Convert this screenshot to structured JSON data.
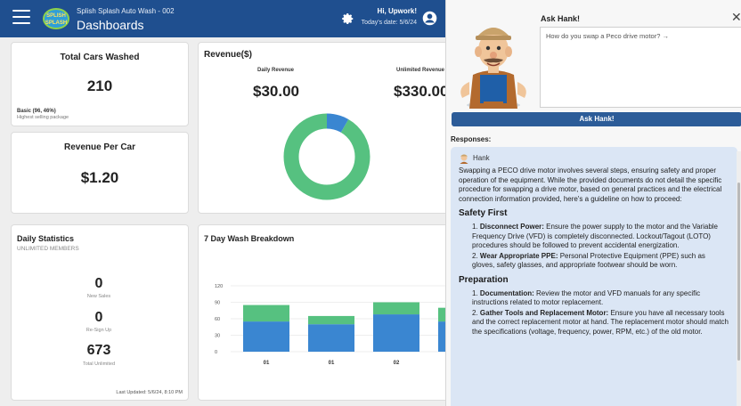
{
  "header": {
    "subtitle": "Splish Splash Auto Wash - 002",
    "title": "Dashboards",
    "logo_text": "SPLISH SPLASH",
    "greeting": "Hi, Upwork!",
    "today": "Today's date: 5/6/24"
  },
  "cards": {
    "total_cars": {
      "title": "Total Cars Washed",
      "value": "210",
      "top_package": "Basic (96, 46%)",
      "top_package_caption": "Highest selling package"
    },
    "revenue_per_car": {
      "title": "Revenue Per Car",
      "value": "$1.20"
    },
    "revenue": {
      "title": "Revenue($)",
      "daily_label": "Daily Revenue",
      "daily_value": "$30.00",
      "unlimited_label": "Unlimited Revenue",
      "unlimited_value": "$330.00",
      "donut": {
        "daily": 30,
        "unlimited": 330,
        "daily_color": "#3a86d1",
        "unlimited_color": "#56c180"
      }
    },
    "daily_stats": {
      "title": "Daily Statistics",
      "subtitle": "UNLIMITED MEMBERS",
      "new_sales": "0",
      "new_sales_label": "New Sales",
      "resign": "0",
      "resign_label": "Re-Sign Up",
      "total": "673",
      "total_label": "Total Unlimited",
      "updated": "Last Updated: 5/6/24, 8:10 PM"
    },
    "wash_breakdown": {
      "title": "7 Day Wash Breakdown"
    }
  },
  "chart_data": {
    "type": "bar",
    "stacked": true,
    "categories": [
      "01",
      "01",
      "02",
      "…"
    ],
    "series": [
      {
        "values": [
          55,
          50,
          68,
          55
        ],
        "color": "#3a86d1"
      },
      {
        "values": [
          30,
          15,
          22,
          25
        ],
        "color": "#56c180"
      }
    ],
    "y_ticks": [
      "0",
      "30",
      "60",
      "90",
      "120"
    ],
    "ylim": [
      0,
      120
    ]
  },
  "ask": {
    "label": "Ask Hank!",
    "question": "How do you swap a Peco drive motor? →",
    "button": "Ask Hank!",
    "responses_label": "Responses:"
  },
  "response": {
    "author": "Hank",
    "intro": "Swapping a PECO drive motor involves several steps, ensuring safety and proper operation of the equipment. While the provided documents do not detail the specific procedure for swapping a drive motor, based on general practices and the electrical connection information provided, here's a guideline on how to proceed:",
    "sections": [
      {
        "heading": "Safety First",
        "items": [
          {
            "num": "1.",
            "bold": "Disconnect Power:",
            "text": " Ensure the power supply to the motor and the Variable Frequency Drive (VFD) is completely disconnected. Lockout/Tagout (LOTO) procedures should be followed to prevent accidental energization."
          },
          {
            "num": "2.",
            "bold": "Wear Appropriate PPE:",
            "text": " Personal Protective Equipment (PPE) such as gloves, safety glasses, and appropriate footwear should be worn."
          }
        ]
      },
      {
        "heading": "Preparation",
        "items": [
          {
            "num": "1.",
            "bold": "Documentation:",
            "text": " Review the motor and VFD manuals for any specific instructions related to motor replacement."
          },
          {
            "num": "2.",
            "bold": "Gather Tools and Replacement Motor:",
            "text": " Ensure you have all necessary tools and the correct replacement motor at hand. The replacement motor should match the specifications (voltage, frequency, power, RPM, etc.) of the old motor."
          }
        ]
      }
    ]
  },
  "icons": {
    "menu": "menu-icon",
    "settings": "gear-icon",
    "account": "account-icon",
    "close": "close-icon",
    "hank": "hank-avatar-icon"
  }
}
